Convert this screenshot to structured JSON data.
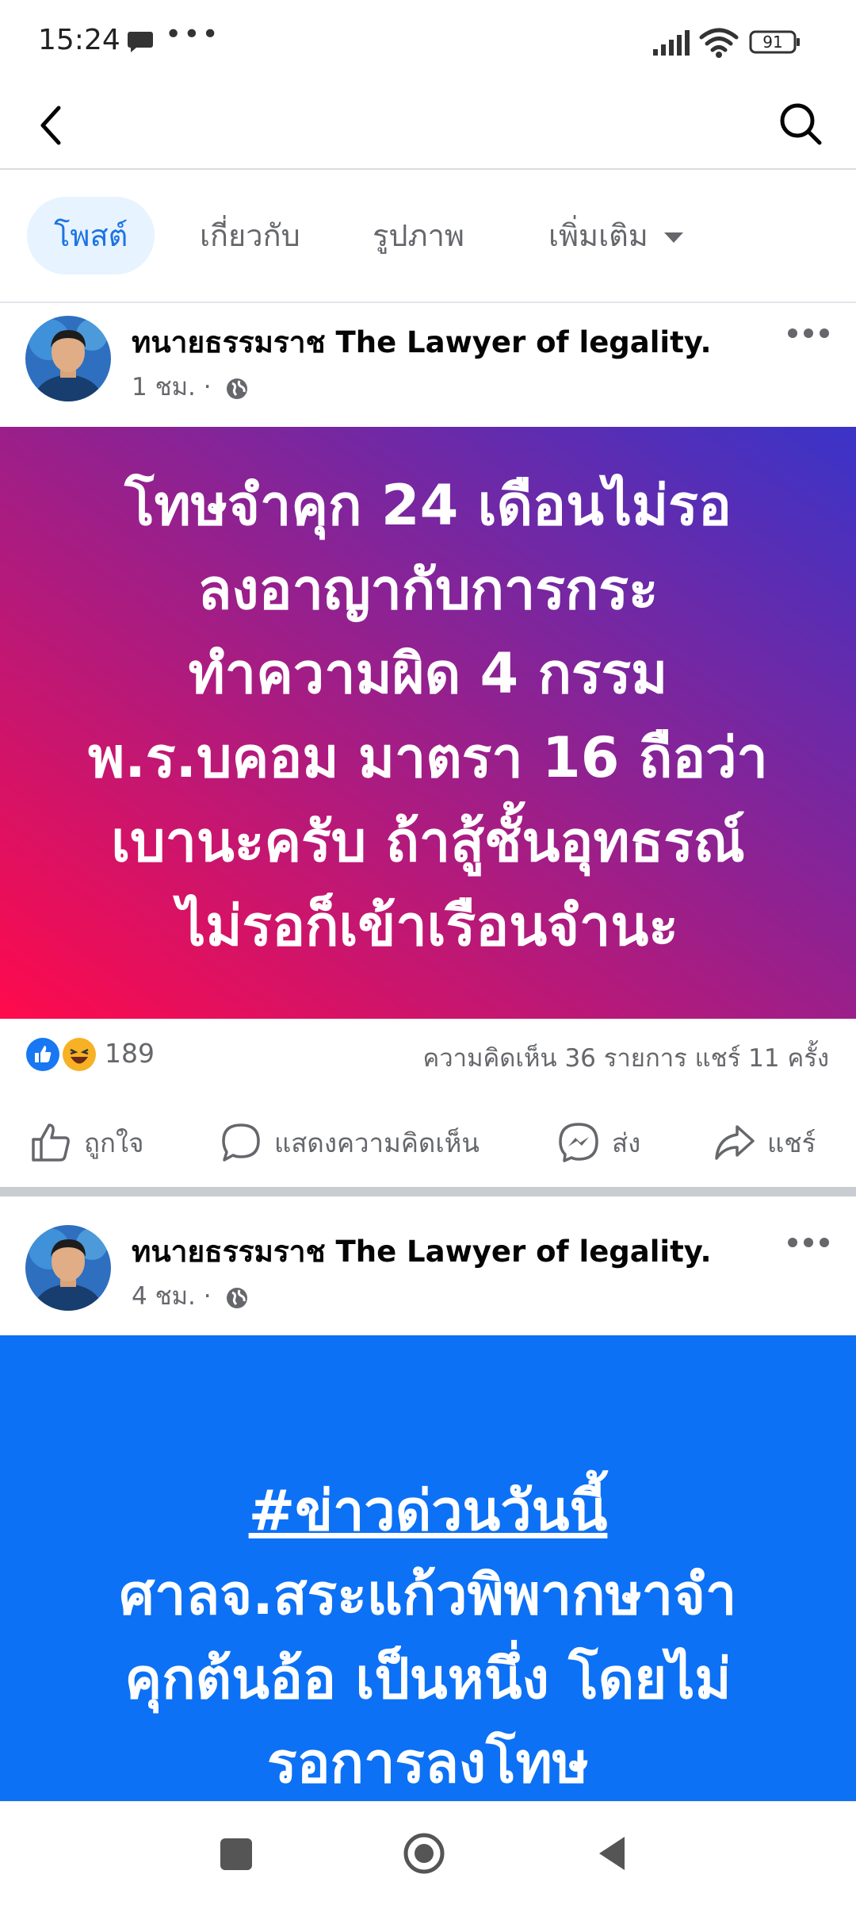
{
  "status_bar": {
    "time": "15:24",
    "battery": "91"
  },
  "header": {
    "back": "back",
    "search": "search"
  },
  "tabs": [
    {
      "label": "โพสต์"
    },
    {
      "label": "เกี่ยวกับ"
    },
    {
      "label": "รูปภาพ"
    },
    {
      "label": "เพิ่มเติม"
    }
  ],
  "post1": {
    "author": "ทนายธรรมราช The Lawyer of  legality.",
    "time": "1 ชม. ·",
    "banner_lines": [
      "โทษจำคุก 24 เดือนไม่รอ",
      "ลงอาญากับการกระ",
      "ทำความผิด 4 กรรม",
      "พ.ร.บคอม มาตรา 16 ถือว่า",
      "เบานะครับ ถ้าสู้ชั้นอุทธรณ์",
      "ไม่รอก็เข้าเรือนจำนะ"
    ],
    "reaction_count": "189",
    "comments_shares": "ความคิดเห็น 36 รายการ  แชร์ 11 ครั้ง"
  },
  "actions": {
    "like": "ถูกใจ",
    "comment": "แสดงความคิดเห็น",
    "send": "ส่ง",
    "share": "แชร์"
  },
  "post2": {
    "author": "ทนายธรรมราช The Lawyer of  legality.",
    "time": "4 ชม. ·",
    "hashtag": "#ข่าวด่วนวันนี้",
    "banner_lines": [
      "ศาลจ.สระแก้วพิพากษาจำ",
      "คุกต้นอ้อ เป็นหนึ่ง โดยไม่",
      "รอการลงโทษ"
    ]
  },
  "colors": {
    "accent": "#1b74e4",
    "banner2_bg": "#0c71f5",
    "gradient_start": "#ff0a4c",
    "gradient_end": "#3a34c8"
  }
}
